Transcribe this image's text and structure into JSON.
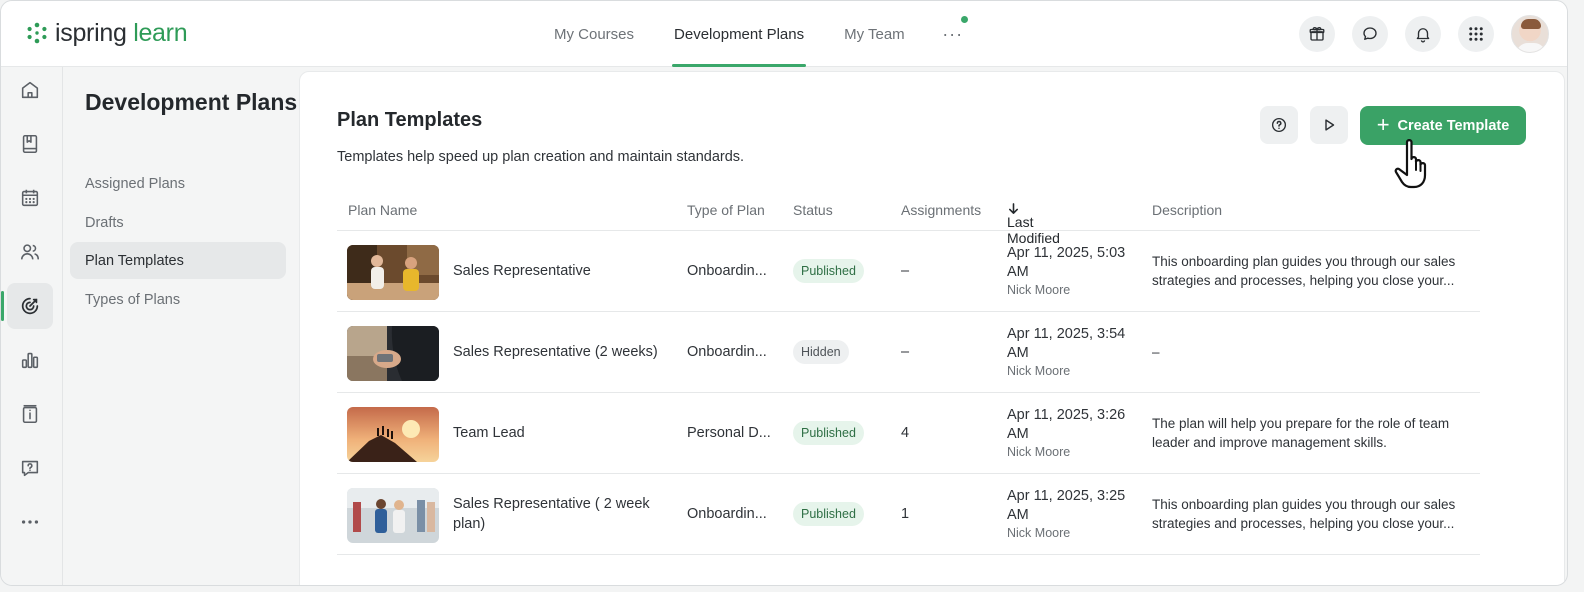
{
  "brand": {
    "name_part1": "ispring",
    "name_part2": "learn",
    "accent": "#3aa266"
  },
  "topnav": {
    "tabs": [
      {
        "label": "My Courses",
        "active": false
      },
      {
        "label": "Development Plans",
        "active": true
      },
      {
        "label": "My Team",
        "active": false
      }
    ],
    "more_label": "···"
  },
  "top_actions": [
    "gift-icon",
    "chat-icon",
    "bell-icon",
    "apps-grid-icon",
    "user-avatar"
  ],
  "rail": [
    "home-icon",
    "book-icon",
    "calendar-icon",
    "users-icon",
    "target-icon",
    "bar-chart-icon",
    "info-board-icon",
    "help-chat-icon",
    "more-icon"
  ],
  "sidebar": {
    "title": "Development Plans",
    "items": [
      {
        "label": "Assigned Plans",
        "active": false
      },
      {
        "label": "Drafts",
        "active": false
      },
      {
        "label": "Plan Templates",
        "active": true
      },
      {
        "label": "Types of Plans",
        "active": false
      }
    ]
  },
  "main": {
    "title": "Plan Templates",
    "subtitle": "Templates help speed up plan creation and maintain standards.",
    "create_label": "Create Template",
    "columns": {
      "name": "Plan Name",
      "type": "Type of Plan",
      "status": "Status",
      "assignments": "Assignments",
      "modified": "Last Modified",
      "description": "Description"
    },
    "rows": [
      {
        "name": "Sales Representative",
        "type": "Onboardin...",
        "status": "Published",
        "assignments": "–",
        "modified": "Apr 11, 2025, 5:03 AM",
        "author": "Nick Moore",
        "description": "This onboarding plan guides you through our sales strategies and processes, helping you close your..."
      },
      {
        "name": "Sales Representative (2 weeks)",
        "type": "Onboardin...",
        "status": "Hidden",
        "assignments": "–",
        "modified": "Apr 11, 2025, 3:54 AM",
        "author": "Nick Moore",
        "description": "–"
      },
      {
        "name": "Team Lead",
        "type": "Personal D...",
        "status": "Published",
        "assignments": "4",
        "modified": "Apr 11, 2025, 3:26 AM",
        "author": "Nick Moore",
        "description": "The plan will help you prepare for the role of team leader and improve management skills."
      },
      {
        "name": "Sales Representative ( 2 week plan)",
        "type": "Onboardin...",
        "status": "Published",
        "assignments": "1",
        "modified": "Apr 11, 2025, 3:25 AM",
        "author": "Nick Moore",
        "description": "This onboarding plan guides you through our sales strategies and processes, helping you close your..."
      }
    ]
  }
}
